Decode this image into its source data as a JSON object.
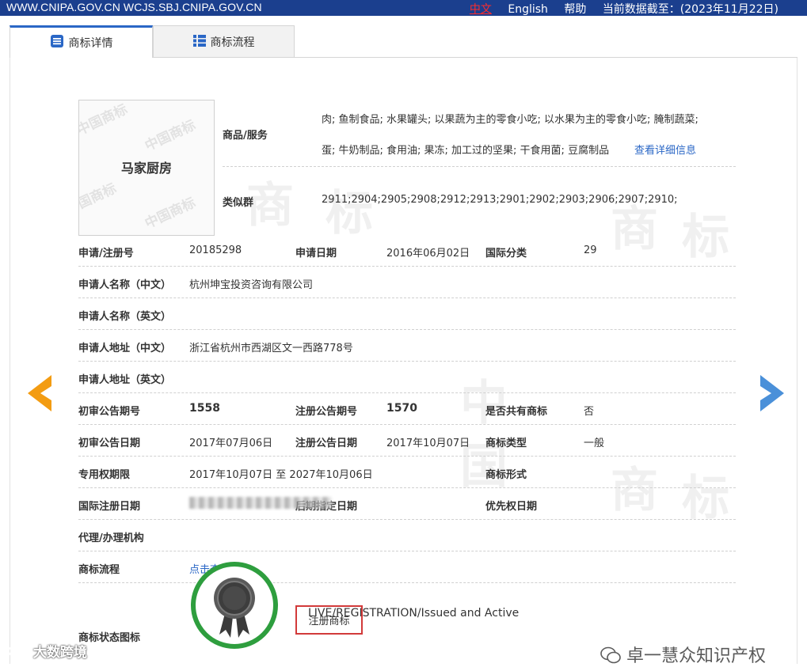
{
  "topbar": {
    "site": "WWW.CNIPA.GOV.CN WCJS.SBJ.CNIPA.GOV.CN",
    "lang_zh": "中文",
    "lang_en": "English",
    "help": "帮助",
    "data_date": "当前数据截至：(2023年11月22日)"
  },
  "tabs": [
    {
      "label": "商标详情",
      "icon": "list-icon",
      "active": true
    },
    {
      "label": "商标流程",
      "icon": "grid-icon",
      "active": false
    }
  ],
  "trademark": {
    "image_text": "马家厨房",
    "image_watermark": "中国商标",
    "goods_label": "商品/服务",
    "goods_line1": "肉; 鱼制食品; 水果罐头; 以果蔬为主的零食小吃; 以水果为主的零食小吃; 腌制蔬菜;",
    "goods_line2": "蛋; 牛奶制品; 食用油; 果冻; 加工过的坚果; 干食用菌; 豆腐制品",
    "goods_more": "查看详细信息",
    "similar_label": "类似群",
    "similar_value": "2911;2904;2905;2908;2912;2913;2901;2902;2903;2906;2907;2910;"
  },
  "fields": {
    "reg_no_label": "申请/注册号",
    "reg_no": "20185298",
    "app_date_label": "申请日期",
    "app_date": "2016年06月02日",
    "intl_class_label": "国际分类",
    "intl_class": "29",
    "applicant_cn_label": "申请人名称（中文）",
    "applicant_cn": "杭州坤宝投资咨询有限公司",
    "applicant_en_label": "申请人名称（英文）",
    "addr_cn_label": "申请人地址（中文）",
    "addr_cn": "浙江省杭州市西湖区文一西路778号",
    "addr_en_label": "申请人地址（英文）",
    "prelim_no_label": "初审公告期号",
    "prelim_no": "1558",
    "reg_pub_no_label": "注册公告期号",
    "reg_pub_no": "1570",
    "shared_label": "是否共有商标",
    "shared": "否",
    "prelim_date_label": "初审公告日期",
    "prelim_date": "2017年07月06日",
    "reg_pub_date_label": "注册公告日期",
    "reg_pub_date": "2017年10月07日",
    "tm_type_label": "商标类型",
    "tm_type": "一般",
    "term_label": "专用权期限",
    "term": "2017年10月07日 至 2027年10月06日",
    "tm_form_label": "商标形式",
    "intl_reg_date_label": "国际注册日期",
    "later_designation_label": "后期指定日期",
    "priority_date_label": "优先权日期",
    "agent_label": "代理/办理机构",
    "process_label": "商标流程",
    "process_link": "点击查看",
    "status_label": "商标状态图标",
    "status_en": "LIVE/REGISTRATION/Issued and Active",
    "status_cn": "注册商标"
  },
  "watermark_chars": [
    "商",
    "标",
    "中",
    "国"
  ],
  "footer": {
    "right_brand": "卓一慧众知识产权",
    "left_brand": "大数跨境"
  },
  "colors": {
    "topbar": "#1b3f8e",
    "link": "#2a67c6",
    "prev_arrow": "#f39c12",
    "next_arrow": "#4a90d9",
    "badge_ring": "#2e9e3e",
    "status_border": "#d23a3a"
  }
}
